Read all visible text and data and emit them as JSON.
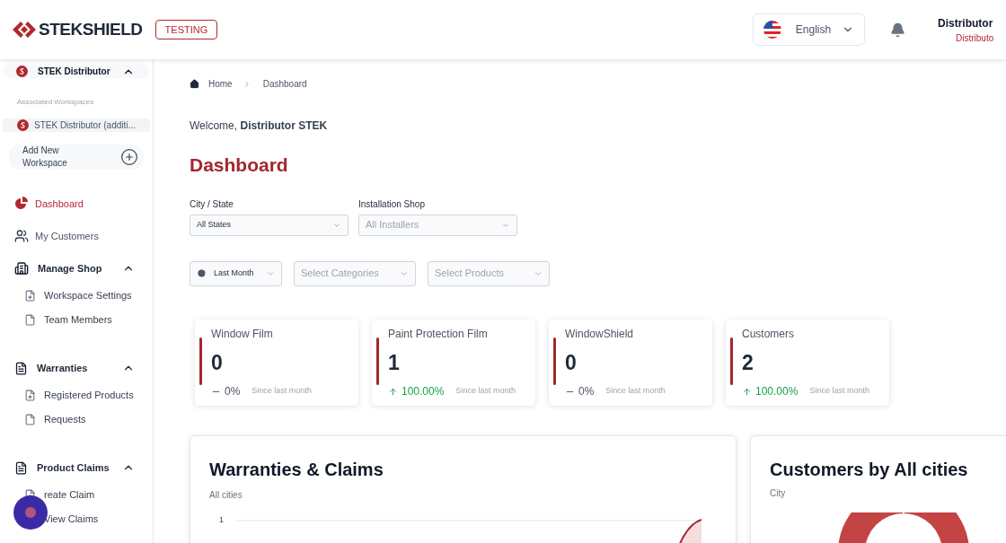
{
  "header": {
    "logo": "STEKSHIELD",
    "env_badge": "TESTING",
    "language": "English",
    "user_name": "Distributor",
    "user_role": "Distributo"
  },
  "sidebar": {
    "workspace": {
      "name": "STEK Distributor",
      "expanded": true
    },
    "associated_label": "Associated Workspaces",
    "associated": [
      {
        "name": "STEK Distributor (additi...",
        "selected": true
      }
    ],
    "add_workspace": "Add New Workspace",
    "nav": [
      {
        "kind": "link",
        "label": "Dashboard",
        "selected": true
      },
      {
        "kind": "link",
        "label": "My Customers",
        "selected": false
      },
      {
        "kind": "group",
        "label": "Manage Shop",
        "expanded": true,
        "children": [
          {
            "label": "Workspace Settings"
          },
          {
            "label": "Team Members"
          }
        ]
      },
      {
        "kind": "group",
        "label": "Warranties",
        "expanded": true,
        "children": [
          {
            "label": "Registered Products"
          },
          {
            "label": "Requests"
          }
        ]
      },
      {
        "kind": "group",
        "label": "Product Claims",
        "expanded": true,
        "children": [
          {
            "label": "reate Claim"
          },
          {
            "label": "View Claims"
          }
        ]
      }
    ]
  },
  "breadcrumb": [
    "Home",
    "Dashboard"
  ],
  "welcome": "Welcome, **Distributor STEK**",
  "title": "Dashboard",
  "filters": [
    {
      "label": "City / State",
      "value": "All States"
    },
    {
      "label": "Installation Shop",
      "placeholder": "All Installers"
    }
  ],
  "filters2": [
    {
      "kind": "period",
      "value": "Last Month"
    },
    {
      "kind": "select",
      "placeholder": "Select Categories"
    },
    {
      "kind": "select",
      "placeholder": "Select Products"
    }
  ],
  "stats": [
    {
      "kind": "unchanged",
      "title": "Window Film",
      "value": "0",
      "change": "0%",
      "note": "Since last month"
    },
    {
      "kind": "increase",
      "title": "Paint Protection Film",
      "value": "1",
      "change": "100.00%",
      "note": "Since last month"
    },
    {
      "kind": "unchanged",
      "title": "WindowShield",
      "value": "0",
      "change": "0%",
      "note": "Since last month"
    },
    {
      "kind": "increase",
      "title": "Customers",
      "value": "2",
      "change": "100.00%",
      "note": "Since last month"
    }
  ],
  "panels": [
    {
      "kind": "line",
      "title": "Warranties & Claims",
      "subtitle": "All cities",
      "tick": "1"
    },
    {
      "kind": "donut",
      "title": "Customers by All cities",
      "subtitle": "City"
    }
  ]
}
